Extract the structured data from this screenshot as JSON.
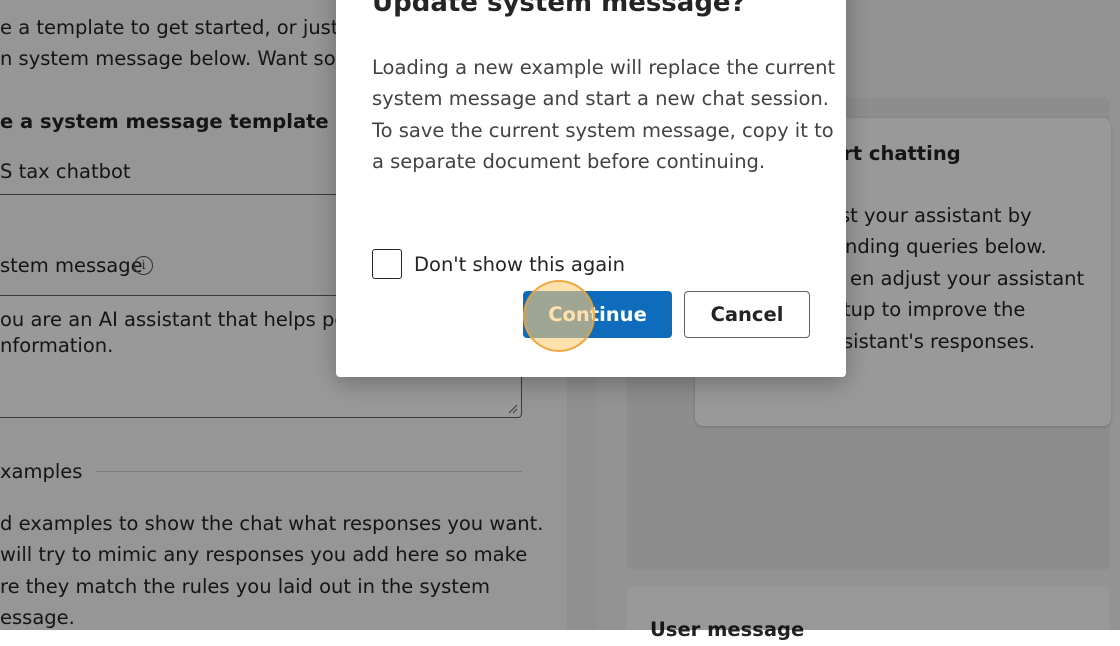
{
  "setup": {
    "intro_line1": "e a template to get started, or just st",
    "intro_line2": "n system message below. Want som",
    "template_label": "e a system message template",
    "template_value": "S tax chatbot",
    "system_message_label": "stem message",
    "info_icon": "info-icon",
    "system_message_line1": "ou are an AI assistant that helps peop",
    "system_message_line2": "nformation.",
    "examples_label": "xamples",
    "examples_line1": "d examples to show the chat what responses you want.",
    "examples_line2": "will try to mimic any responses you add here so make",
    "examples_line3": "re they match the rules you laid out in the system",
    "examples_line4": "essage."
  },
  "chat": {
    "start_title": "art chatting",
    "start_line1": "st your assistant by",
    "start_line2": "nding queries below.",
    "start_line3": "en adjust your assistant",
    "start_line4": "tup to improve the",
    "start_line5": "sistant's responses.",
    "user_message_label": "User message"
  },
  "dialog": {
    "title": "Update system message?",
    "body_line1": "Loading a new example will replace the current",
    "body_line2": "system message and start a new chat session.",
    "body_line3": "To save the current system message, copy it to",
    "body_line4": "a separate document before continuing.",
    "checkbox_label": "Don't show this again",
    "checkbox_checked": false,
    "continue_label": "Continue",
    "cancel_label": "Cancel"
  },
  "colors": {
    "primary": "#0f6cbd",
    "overlay": "rgba(0,0,0,0.4)",
    "click_highlight": "#f5c06a"
  }
}
